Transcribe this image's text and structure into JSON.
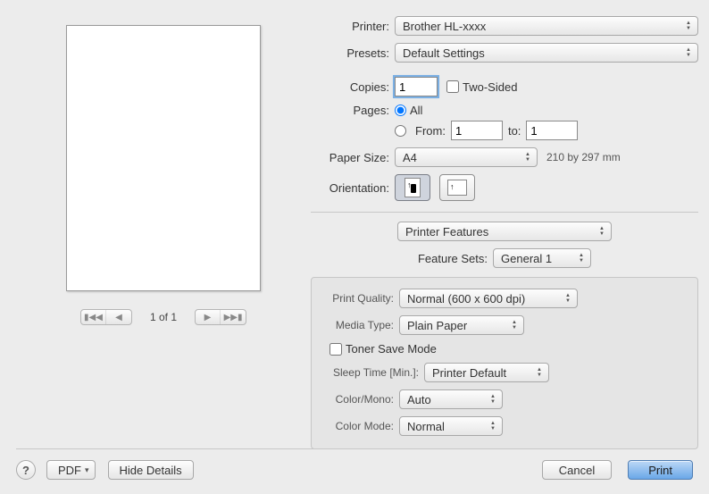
{
  "labels": {
    "printer": "Printer:",
    "presets": "Presets:",
    "copies": "Copies:",
    "two_sided": "Two-Sided",
    "pages": "Pages:",
    "all": "All",
    "from": "From:",
    "to": "to:",
    "paper_size": "Paper Size:",
    "orientation": "Orientation:",
    "feature_sets": "Feature Sets:",
    "print_quality": "Print Quality:",
    "media_type": "Media Type:",
    "toner_save": "Toner Save Mode",
    "sleep_time": "Sleep Time [Min.]:",
    "color_mono": "Color/Mono:",
    "color_mode": "Color Mode:"
  },
  "values": {
    "printer": "Brother HL-xxxx",
    "presets": "Default Settings",
    "copies": "1",
    "two_sided_checked": false,
    "pages_mode": "all",
    "page_from": "1",
    "page_to": "1",
    "paper_size": "A4",
    "paper_dim": "210 by 297 mm",
    "orientation": "portrait",
    "section": "Printer Features",
    "feature_set": "General 1",
    "print_quality": "Normal (600 x 600 dpi)",
    "media_type": "Plain Paper",
    "toner_save_checked": false,
    "sleep_time": "Printer Default",
    "color_mono": "Auto",
    "color_mode": "Normal"
  },
  "preview": {
    "page_indicator": "1 of 1"
  },
  "buttons": {
    "help": "?",
    "pdf": "PDF",
    "hide_details": "Hide Details",
    "cancel": "Cancel",
    "print": "Print"
  }
}
